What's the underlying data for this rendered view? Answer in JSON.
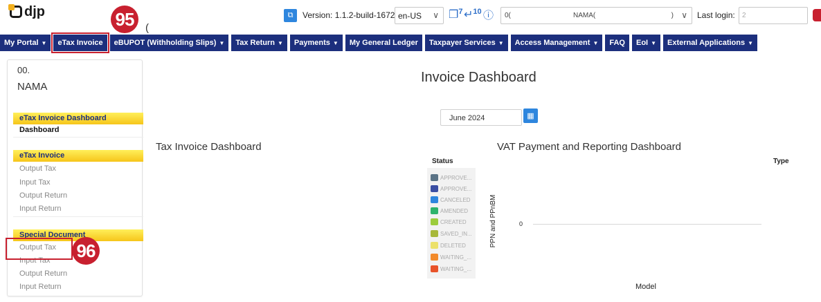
{
  "header": {
    "logo_text": "djp",
    "version_text": "Version: 1.1.2-build-1672",
    "language": "en-US",
    "notif1_count": "7",
    "notif2_count": "10",
    "user_id": "0(",
    "user_name": "NAMA(",
    "user_tail": ")",
    "last_login_label": "Last login:",
    "last_login_value": "2"
  },
  "badges": {
    "step1": "95",
    "step2": "96"
  },
  "nav": {
    "items": [
      {
        "label": "My Portal",
        "dropdown": true
      },
      {
        "label": "eTax Invoice",
        "dropdown": false,
        "highlight": true
      },
      {
        "label": "eBUPOT (Withholding Slips)",
        "dropdown": true
      },
      {
        "label": "Tax Return",
        "dropdown": true
      },
      {
        "label": "Payments",
        "dropdown": true
      },
      {
        "label": "My General Ledger",
        "dropdown": false
      },
      {
        "label": "Taxpayer Services",
        "dropdown": true
      },
      {
        "label": "Access Management",
        "dropdown": true
      },
      {
        "label": "FAQ",
        "dropdown": false
      },
      {
        "label": "EoI",
        "dropdown": true
      },
      {
        "label": "External Applications",
        "dropdown": true
      }
    ]
  },
  "sidebar": {
    "id": "00.",
    "name": "NAMA",
    "name_end": "(",
    "sections": [
      {
        "heading": "eTax Invoice Dashboard",
        "links": [
          "Dashboard"
        ]
      },
      {
        "heading": "eTax Invoice",
        "links": [
          "Output Tax",
          "Input Tax",
          "Output Return",
          "Input Return"
        ]
      },
      {
        "heading": "Special Document",
        "links": [
          "Output Tax",
          "Input Tax",
          "Output Return",
          "Input Return"
        ]
      }
    ]
  },
  "main": {
    "title": "Invoice Dashboard",
    "period": "June 2024",
    "left_title": "Tax Invoice Dashboard",
    "right_title": "VAT Payment and Reporting Dashboard",
    "status_label": "Status",
    "type_label": "Type",
    "legend": [
      {
        "label": "APPROVE...",
        "color": "#5b7386"
      },
      {
        "label": "APPROVE...",
        "color": "#3a4ea3"
      },
      {
        "label": "CANCELED",
        "color": "#2e86de"
      },
      {
        "label": "AMENDED",
        "color": "#2db36b"
      },
      {
        "label": "CREATED",
        "color": "#9ccc3c"
      },
      {
        "label": "SAVED_IN...",
        "color": "#a7b83a"
      },
      {
        "label": "DELETED",
        "color": "#ece16a"
      },
      {
        "label": "WAITING_...",
        "color": "#f28a2a"
      },
      {
        "label": "WAITING_...",
        "color": "#e8532a"
      }
    ],
    "y_axis_label": "PPN and PPnBM",
    "zero_tick": "0",
    "x_axis_label": "Model"
  }
}
